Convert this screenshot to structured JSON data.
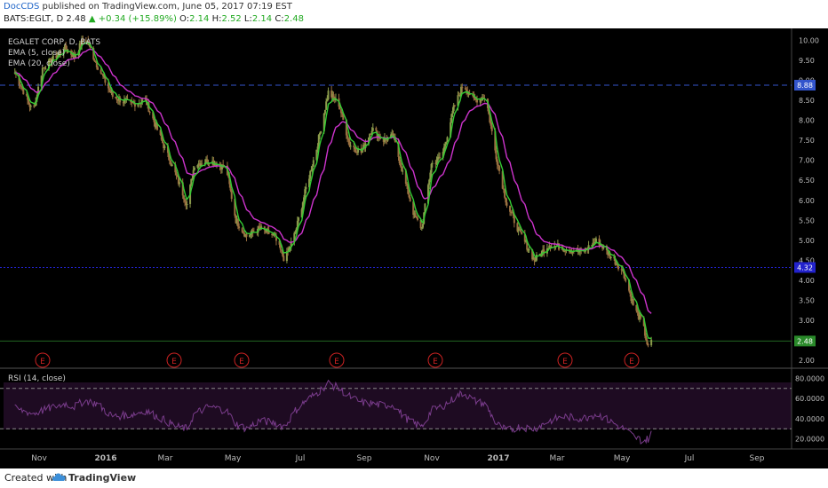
{
  "header": {
    "author": "DocCDS",
    "published_text": "published on TradingView.com, June 05, 2017 07:19 EST",
    "symbol": "BATS:EGLT, D",
    "last": "2.48",
    "change": "+0.34 (+15.89%)",
    "o_label": "O:",
    "o_value": "2.14",
    "h_label": "H:",
    "h_value": "2.52",
    "l_label": "L:",
    "l_value": "2.14",
    "c_label": "C:",
    "c_value": "2.48"
  },
  "legend": {
    "series": "EGALET CORP, D, BATS",
    "ema_fast": "EMA (5, close)",
    "ema_slow": "EMA (20, close)"
  },
  "footer": {
    "created_with": "Created with",
    "brand": "TradingView"
  },
  "colors": {
    "background": "#000000",
    "candle_up": "#8a9a4a",
    "candle_down": "#9a7040",
    "ema_fast": "#33cc33",
    "ema_slow": "#cc33cc",
    "rsi": "#7a3c8c",
    "rsi_band": "#1e0b22",
    "hline_upper": "#3355cc",
    "hline_lower": "#2222cc",
    "last_price_line": "#226622",
    "earnings": "#cc2222"
  },
  "chart_data": [
    {
      "type": "line",
      "title": "EGALET CORP, D, BATS",
      "y_axis": {
        "range": [
          1.8,
          10.3
        ],
        "ticks": [
          "10.00",
          "9.50",
          "9.00",
          "8.50",
          "8.00",
          "7.50",
          "7.00",
          "6.50",
          "6.00",
          "5.50",
          "5.00",
          "4.50",
          "4.00",
          "3.50",
          "3.00",
          "2.50",
          "2.00"
        ]
      },
      "x_axis": {
        "ticks": [
          "Nov",
          "2016",
          "Mar",
          "May",
          "Jul",
          "Sep",
          "Nov",
          "2017",
          "Mar",
          "May",
          "Jul",
          "Sep"
        ]
      },
      "price_labels": [
        {
          "text": "8.88",
          "value": 8.88
        },
        {
          "text": "4.32",
          "value": 4.32
        },
        {
          "text": "2.48",
          "value": 2.48
        }
      ],
      "series": [
        {
          "name": "EGALET CORP, D, BATS",
          "x": [
            "2015-10-15",
            "2015-11-01",
            "2015-11-10",
            "2015-12-01",
            "2015-12-10",
            "2015-12-20",
            "2015-12-31",
            "2016-01-15",
            "2016-02-01",
            "2016-02-15",
            "2016-03-01",
            "2016-03-15",
            "2016-03-25",
            "2016-04-01",
            "2016-04-15",
            "2016-05-01",
            "2016-05-10",
            "2016-05-20",
            "2016-06-01",
            "2016-06-15",
            "2016-06-25",
            "2016-07-05",
            "2016-07-15",
            "2016-07-25",
            "2016-08-05",
            "2016-08-15",
            "2016-08-25",
            "2016-09-05",
            "2016-09-15",
            "2016-09-25",
            "2016-10-05",
            "2016-10-15",
            "2016-10-25",
            "2016-11-01",
            "2016-11-10",
            "2016-11-20",
            "2016-12-01",
            "2016-12-10",
            "2016-12-20",
            "2016-12-31",
            "2017-01-10",
            "2017-01-20",
            "2017-02-01",
            "2017-02-15",
            "2017-03-01",
            "2017-03-15",
            "2017-04-01",
            "2017-04-15",
            "2017-05-01",
            "2017-05-10",
            "2017-05-20",
            "2017-05-28",
            "2017-06-02",
            "2017-06-05"
          ],
          "values": [
            9.2,
            8.2,
            9.3,
            9.8,
            9.6,
            10.1,
            9.4,
            8.6,
            8.4,
            8.5,
            7.5,
            6.6,
            5.9,
            6.9,
            7.0,
            6.8,
            5.5,
            5.1,
            5.3,
            5.1,
            4.5,
            5.2,
            6.3,
            7.3,
            8.7,
            8.4,
            7.4,
            7.2,
            7.8,
            7.5,
            7.6,
            6.6,
            5.6,
            5.3,
            6.9,
            7.1,
            8.3,
            8.9,
            8.5,
            8.6,
            7.1,
            5.9,
            5.2,
            4.5,
            4.9,
            4.8,
            4.7,
            5.0,
            4.5,
            4.2,
            3.3,
            2.9,
            2.3,
            2.48
          ]
        }
      ],
      "overlays": [
        "EMA (5, close)",
        "EMA (20, close)"
      ],
      "markers": {
        "label": "E",
        "count": 7
      }
    },
    {
      "type": "line",
      "title": "RSI (14, close)",
      "y_axis": {
        "range": [
          10,
          90
        ],
        "ticks": [
          "80.0000",
          "60.0000",
          "40.0000",
          "20.0000"
        ]
      },
      "bands": [
        70,
        30
      ],
      "series": [
        {
          "name": "RSI (14, close)",
          "x": [
            "2015-10-15",
            "2015-11-01",
            "2015-11-10",
            "2015-12-01",
            "2015-12-10",
            "2015-12-20",
            "2015-12-31",
            "2016-01-15",
            "2016-02-01",
            "2016-02-15",
            "2016-03-01",
            "2016-03-15",
            "2016-03-25",
            "2016-04-01",
            "2016-04-15",
            "2016-05-01",
            "2016-05-10",
            "2016-05-20",
            "2016-06-01",
            "2016-06-15",
            "2016-06-25",
            "2016-07-05",
            "2016-07-15",
            "2016-07-25",
            "2016-08-05",
            "2016-08-15",
            "2016-08-25",
            "2016-09-05",
            "2016-09-15",
            "2016-09-25",
            "2016-10-05",
            "2016-10-15",
            "2016-10-25",
            "2016-11-01",
            "2016-11-10",
            "2016-11-20",
            "2016-12-01",
            "2016-12-10",
            "2016-12-20",
            "2016-12-31",
            "2017-01-10",
            "2017-01-20",
            "2017-02-01",
            "2017-02-15",
            "2017-03-01",
            "2017-03-15",
            "2017-04-01",
            "2017-04-15",
            "2017-05-01",
            "2017-05-10",
            "2017-05-20",
            "2017-05-28",
            "2017-06-02",
            "2017-06-05"
          ],
          "values": [
            50,
            45,
            48,
            55,
            52,
            58,
            55,
            42,
            44,
            48,
            40,
            32,
            30,
            45,
            52,
            48,
            35,
            30,
            38,
            36,
            32,
            48,
            58,
            65,
            75,
            70,
            62,
            56,
            55,
            53,
            54,
            42,
            35,
            32,
            48,
            52,
            60,
            66,
            58,
            54,
            35,
            28,
            32,
            30,
            38,
            42,
            40,
            45,
            35,
            30,
            22,
            18,
            20,
            28
          ]
        }
      ]
    }
  ]
}
